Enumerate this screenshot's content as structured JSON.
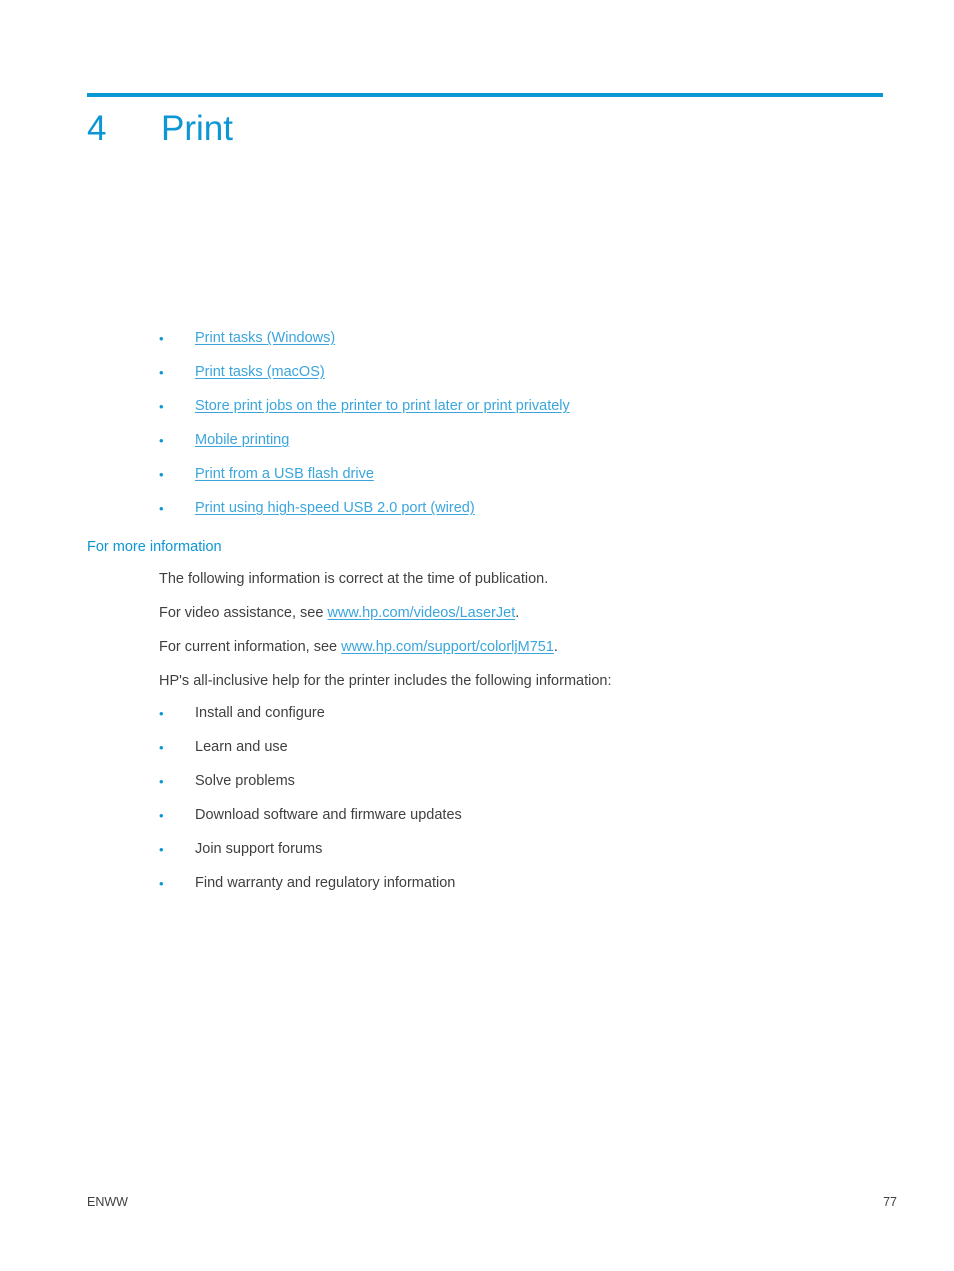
{
  "chapter": {
    "number": "4",
    "title": "Print",
    "rule_color": "#0d96d4",
    "title_color": "#0d96d4"
  },
  "toc": {
    "bullet_glyph": "•",
    "link_color": "#3aa5dd",
    "items": [
      {
        "label": "Print tasks (Windows)"
      },
      {
        "label": "Print tasks (macOS)"
      },
      {
        "label": "Store print jobs on the printer to print later or print privately"
      },
      {
        "label": "Mobile printing"
      },
      {
        "label": "Print from a USB flash drive"
      },
      {
        "label": "Print using high-speed USB 2.0 port (wired)"
      }
    ]
  },
  "more_info": {
    "heading": "For more information",
    "paragraph_1": "The following information is correct at the time of publication.",
    "video_line_prefix": "For video assistance, see ",
    "video_link": "www.hp.com/videos/LaserJet",
    "video_line_suffix": ".",
    "current_line_prefix": "For current information, see ",
    "current_link": "www.hp.com/support/colorljM751",
    "current_line_suffix": ".",
    "help_intro": "HP's all-inclusive help for the printer includes the following information:",
    "features": [
      {
        "label": "Install and configure"
      },
      {
        "label": "Learn and use"
      },
      {
        "label": "Solve problems"
      },
      {
        "label": "Download software and firmware updates"
      },
      {
        "label": "Join support forums"
      },
      {
        "label": "Find warranty and regulatory information"
      }
    ]
  },
  "footer": {
    "locale": "ENWW",
    "page_number": "77"
  }
}
